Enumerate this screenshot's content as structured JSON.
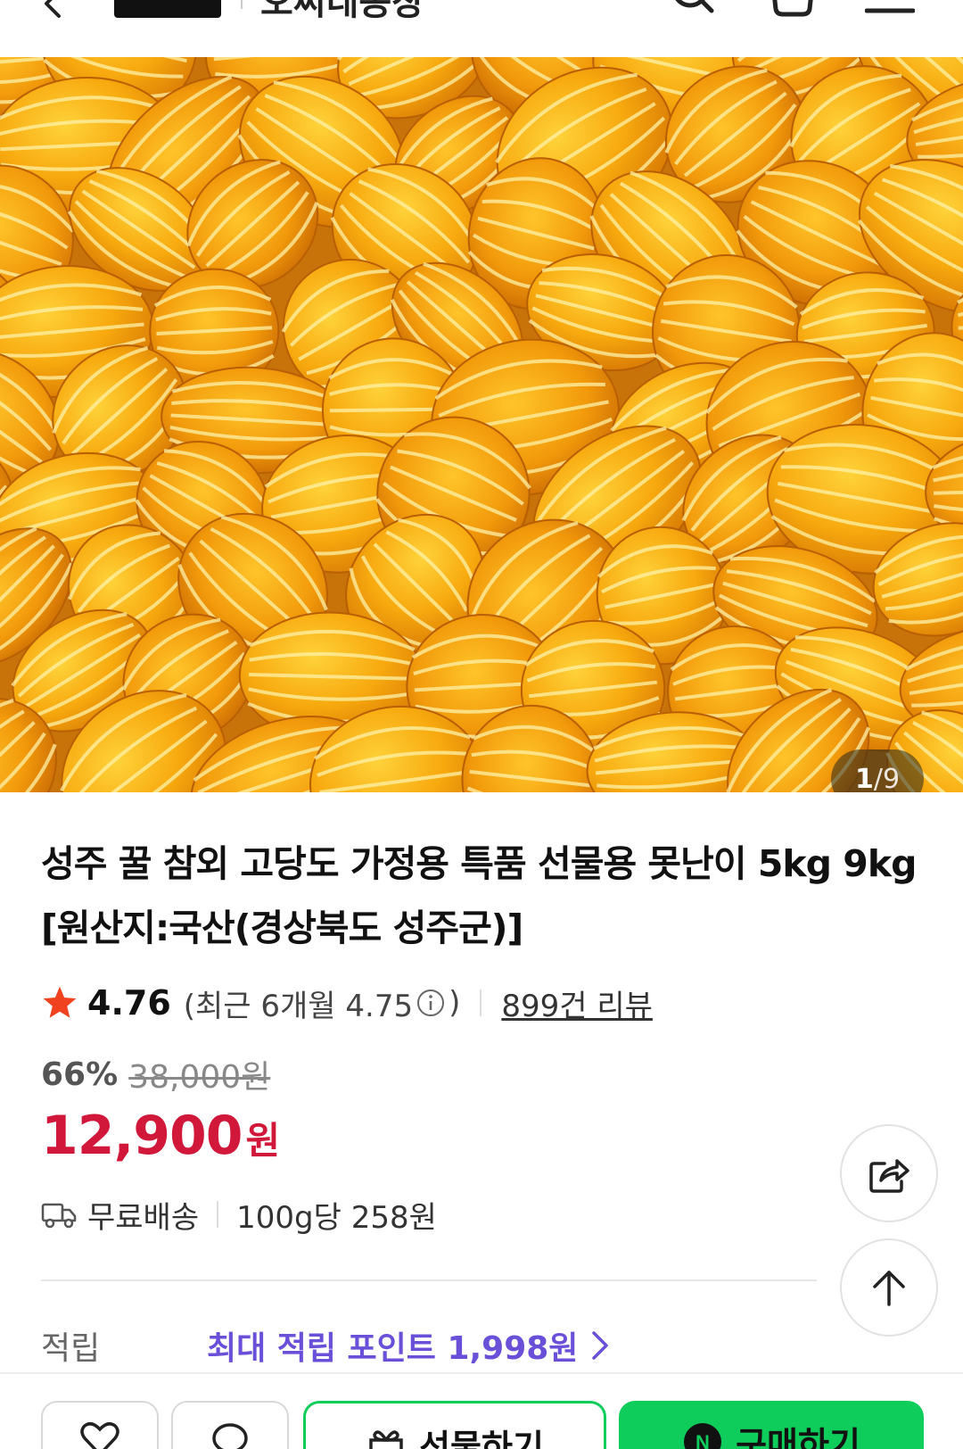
{
  "header": {
    "store_name": "오씨네농장",
    "icons": [
      "back-icon",
      "search-icon",
      "cart-icon",
      "menu-icon"
    ]
  },
  "gallery": {
    "current": "1",
    "separator": "/",
    "total": "9"
  },
  "product": {
    "title": "성주 꿀 참외 고당도 가정용 특품 선물용 못난이 5kg 9kg [원산지:국산(경상북도 성주군)]",
    "rating": "4.76",
    "recent_rating_text": "(최근 6개월 4.75",
    "recent_rating_close": ")",
    "review_count": "899건 리뷰",
    "discount_rate": "66%",
    "original_price": "38,000원",
    "sale_price": "12,900",
    "sale_unit": "원",
    "shipping": "무료배송",
    "unit_price": "100g당 258원"
  },
  "points": {
    "label": "적립",
    "value": "최대 적립 포인트 1,998원"
  },
  "bottom_bar": {
    "gift_label": "선물하기",
    "buy_label": "구매하기"
  },
  "colors": {
    "sale_price": "#d1173a",
    "points": "#6a4fd8",
    "buy_button": "#0fcd5b",
    "star": "#f0421e"
  }
}
